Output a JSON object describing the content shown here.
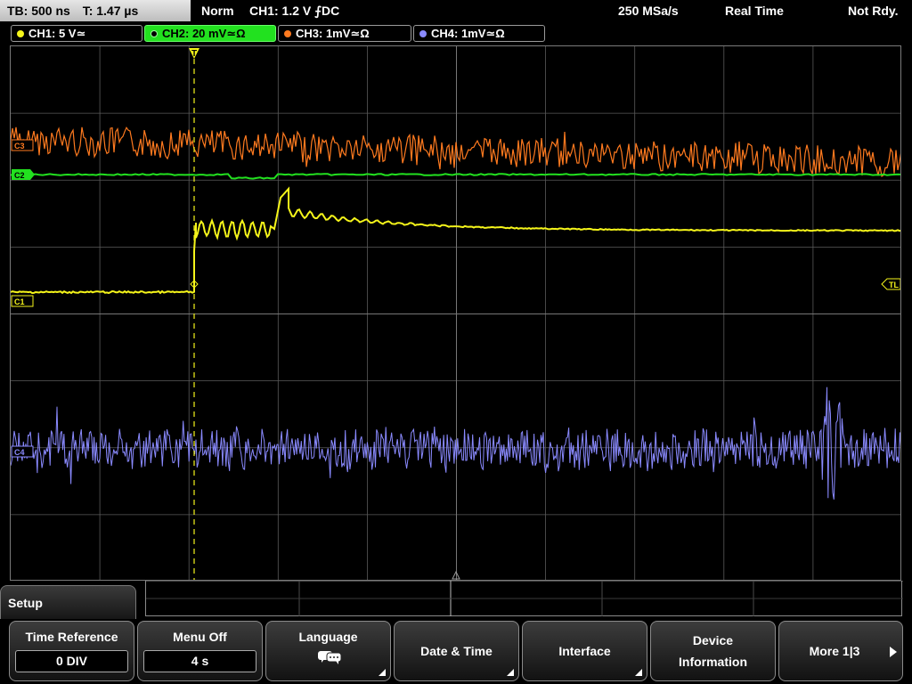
{
  "topbar": {
    "timebase": "TB: 500 ns",
    "trigger_time": "T: 1.47 µs",
    "mode": "Norm",
    "trigger": "CH1: 1.2 V ⨍DC",
    "sample_rate": "250 MSa/s",
    "acq_mode": "Real Time",
    "status": "Not Rdy."
  },
  "channels": [
    {
      "label": "CH1: 5 V≃",
      "color": "#f5f51a",
      "active": false
    },
    {
      "label": "CH2: 20 mV≃Ω",
      "color": "#22e11f",
      "active": true
    },
    {
      "label": "CH3: 1mV≃Ω",
      "color": "#ff7a1f",
      "active": false
    },
    {
      "label": "CH4: 1mV≃Ω",
      "color": "#8a8aff",
      "active": false
    }
  ],
  "markers": {
    "c1": "C1",
    "c2": "C2",
    "c3": "C3",
    "c4": "C4",
    "tl": "TL",
    "trigger_marker": "T"
  },
  "colors": {
    "ch1": "#f5f51a",
    "ch2": "#22e11f",
    "ch3": "#ff7a1f",
    "ch4": "#8a8aff",
    "grid": "#5a5a5a"
  },
  "menu": {
    "title": "Setup"
  },
  "softkeys": {
    "time_reference": {
      "label": "Time Reference",
      "value": "0 DIV"
    },
    "menu_off": {
      "label": "Menu Off",
      "value": "4 s"
    },
    "language": {
      "label": "Language",
      "icon": "speech-bubble-icon"
    },
    "date_time": {
      "label": "Date & Time"
    },
    "interface": {
      "label": "Interface"
    },
    "device_info": {
      "line1": "Device",
      "line2": "Information"
    },
    "more": {
      "label": "More 1|3",
      "icon": "arrow-right-icon"
    }
  }
}
